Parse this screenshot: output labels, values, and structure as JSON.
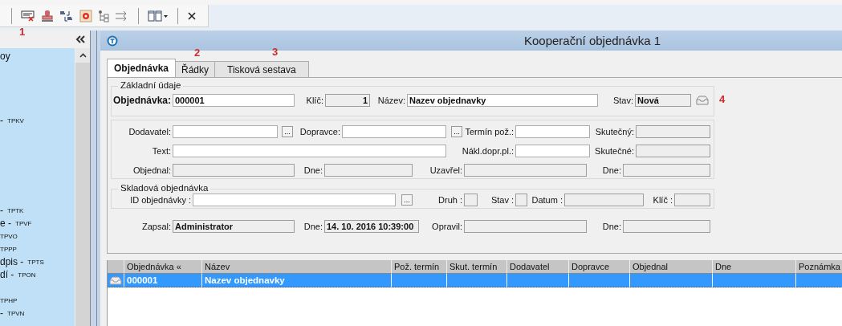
{
  "annotations": [
    {
      "text": "1"
    },
    {
      "text": "2"
    },
    {
      "text": "3"
    },
    {
      "text": "4"
    }
  ],
  "sidebar": {
    "items": [
      {
        "name": "oy"
      },
      {
        "name": "-",
        "code": "TPKV"
      },
      {
        "name": "-",
        "code": "TPTK"
      },
      {
        "name": "e -",
        "code": "TPVF"
      },
      {
        "code": "TPVO"
      },
      {
        "code": "TPPP"
      },
      {
        "name": "dpis -",
        "code": "TPTS"
      },
      {
        "name": "dí -",
        "code": "TPON"
      },
      {
        "code": "TPHP"
      },
      {
        "name": "-",
        "code": "TPVN"
      }
    ]
  },
  "window": {
    "title": "Kooperační objednávka 1"
  },
  "tabs": [
    {
      "label": "Objednávka",
      "selected": true
    },
    {
      "label": "Řádky",
      "selected": false
    },
    {
      "label": "Tisková sestava",
      "selected": false
    }
  ],
  "basic": {
    "legend": "Základní údaje",
    "fields": [
      {
        "label": "Objednávka:",
        "kind": "key",
        "value": "000001"
      },
      {
        "label": "Klíč:",
        "kind": "number",
        "value": "1"
      },
      {
        "label": "Název:",
        "kind": "input",
        "value": "Nazev objednavky"
      },
      {
        "label": "Stav:",
        "kind": "readonly",
        "value": "Nová"
      }
    ]
  },
  "details": {
    "rows": [
      {
        "fields": [
          {
            "label": "Dodavatel:",
            "kind": "input",
            "button": "..."
          },
          {
            "label": "Dopravce:",
            "kind": "input",
            "button": "..."
          },
          {
            "label": "Termín pož.:",
            "kind": "input"
          },
          {
            "label": "Skutečný:",
            "kind": "readonly"
          }
        ]
      },
      {
        "fields": [
          {
            "label": "Text:",
            "kind": "input"
          },
          {
            "label": "Nákl.dopr.pl.:",
            "kind": "input"
          },
          {
            "label": "Skutečné:",
            "kind": "readonly"
          }
        ]
      },
      {
        "fields": [
          {
            "label": "Objednal:",
            "kind": "readonly"
          },
          {
            "label": "Dne:",
            "kind": "readonly"
          },
          {
            "label": "Uzavřel:",
            "kind": "readonly"
          },
          {
            "label": "Dne:",
            "kind": "readonly"
          }
        ]
      }
    ]
  },
  "stock": {
    "legend": "Skladová objednávka",
    "fields": [
      {
        "label": "ID objednávky :",
        "kind": "input",
        "button": "..."
      },
      {
        "label": "Druh :",
        "kind": "readonly"
      },
      {
        "label": "Stav :",
        "kind": "readonly"
      },
      {
        "label": "Datum :",
        "kind": "readonly"
      },
      {
        "label": "Klíč :",
        "kind": "readonly"
      }
    ]
  },
  "audit": {
    "fields": [
      {
        "label": "Zapsal:",
        "kind": "readonly",
        "value": "Administrator"
      },
      {
        "label": "Dne:",
        "kind": "readonly",
        "value": "14. 10. 2016 10:39:00"
      },
      {
        "label": "Opravil:",
        "kind": "readonly"
      },
      {
        "label": "Dne:",
        "kind": "readonly"
      }
    ]
  },
  "grid": {
    "columns": [
      "Objednávka «",
      "Název",
      "Pož. termín",
      "Skut. termín",
      "Dodavatel",
      "Dopravce",
      "Objednal",
      "Dne",
      "Poznámka"
    ],
    "rows": [
      {
        "selected": true,
        "cells": [
          "000001",
          "Nazev objednavky"
        ]
      }
    ]
  }
}
